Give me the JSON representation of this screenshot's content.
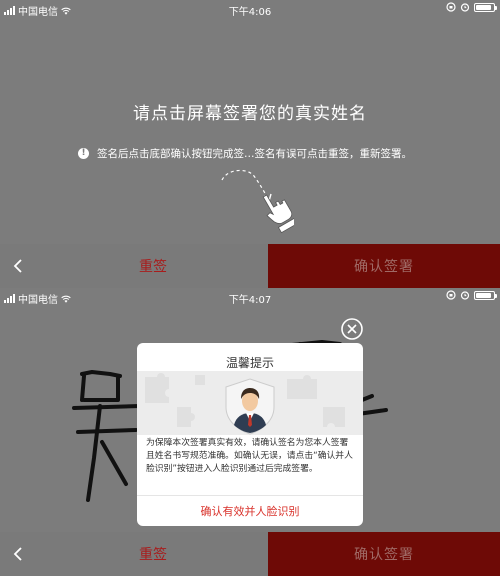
{
  "status_bar": {
    "carrier": "中国电信",
    "time_top": "下午4:06",
    "time_bottom": "下午4:07"
  },
  "sign_hint": {
    "title": "请点击屏幕签署您的真实姓名",
    "subtitle": "签名后点击底部确认按钮完成签…签名有误可点击重签，重新签署。"
  },
  "bottom_bar": {
    "back_icon": "chevron-left-icon",
    "resign_label": "重签",
    "confirm_label": "确认签署"
  },
  "dialog": {
    "title": "温馨提示",
    "body": "为保障本次签署真实有效，请确认签名为您本人签署且姓名书写规范准确。如确认无误，请点击“确认并人脸识别”按钮进入人脸识别通过后完成签署。",
    "action_label": "确认有效并人脸识别",
    "avatar_icon": "business-man-shield-icon",
    "close_icon": "close-circle-icon"
  },
  "colors": {
    "overlay_gray": "#7c7c7c",
    "resign_red": "#a81c1c",
    "confirm_bg": "#6e0a06",
    "action_red": "#d9312a"
  }
}
